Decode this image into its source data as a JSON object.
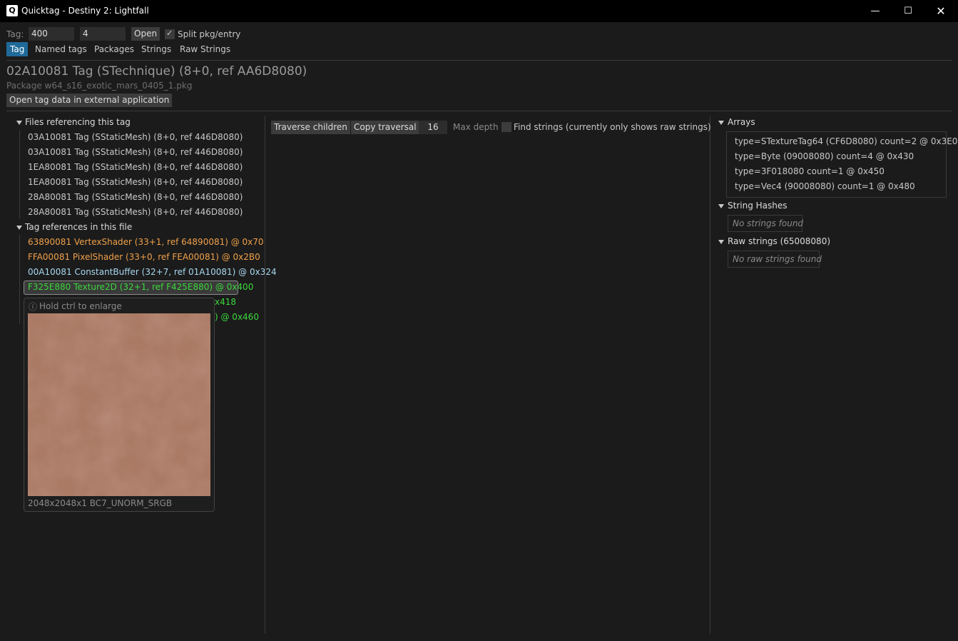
{
  "window": {
    "title": "Quicktag - Destiny 2: Lightfall",
    "icon_letter": "Q"
  },
  "toolbar": {
    "tag_label": "Tag:",
    "tag_value": "400",
    "entry_value": "4",
    "open_label": "Open",
    "split_label": "Split pkg/entry",
    "split_checked": true
  },
  "tabs": [
    "Tag",
    "Named tags",
    "Packages",
    "Strings",
    "Raw Strings"
  ],
  "header": {
    "title": "02A10081 Tag (STechnique) (8+0, ref AA6D8080)",
    "package": "Package w64_s16_exotic_mars_0405_1.pkg",
    "open_external": "Open tag data in external application"
  },
  "left": {
    "files_ref_title": "Files referencing this tag",
    "files_ref": [
      "03A10081 Tag (SStaticMesh) (8+0, ref 446D8080)",
      "03A10081 Tag (SStaticMesh) (8+0, ref 446D8080)",
      "1EA80081 Tag (SStaticMesh) (8+0, ref 446D8080)",
      "1EA80081 Tag (SStaticMesh) (8+0, ref 446D8080)",
      "28A80081 Tag (SStaticMesh) (8+0, ref 446D8080)",
      "28A80081 Tag (SStaticMesh) (8+0, ref 446D8080)"
    ],
    "tag_refs_title": "Tag references in this file",
    "tag_refs": [
      "63890081 VertexShader (33+1, ref 64890081) @ 0x70",
      "FFA00081 PixelShader (33+0, ref FEA00081) @ 0x2B0",
      "00A10081 ConstantBuffer (32+7, ref 01A10081) @ 0x324",
      "F325E880 Texture2D (32+1, ref F425E880) @ 0x400"
    ],
    "tag_refs_partial": [
      "x418",
      ") @ 0x460"
    ]
  },
  "tooltip": {
    "hint": "Hold ctrl to enlarge",
    "info": "2048x2048x1 BC7_UNORM_SRGB"
  },
  "middle": {
    "traverse_label": "Traverse children",
    "copy_label": "Copy traversal",
    "max_depth_value": "16",
    "max_depth_label": "Max depth",
    "find_strings_label": "Find strings (currently only shows raw strings)"
  },
  "right": {
    "arrays_title": "Arrays",
    "arrays": [
      "type=STextureTag64 (CF6D8080) count=2 @ 0x3E0",
      "type=Byte (09008080) count=4 @ 0x430",
      "type=3F018080 count=1 @ 0x450",
      "type=Vec4 (90008080) count=1 @ 0x480"
    ],
    "string_hashes_title": "String Hashes",
    "no_strings": "No strings found",
    "raw_strings_title": "Raw strings (65008080)",
    "no_raw_strings": "No raw strings found"
  },
  "colors": {
    "accent": "#1f6a99",
    "vertex_shader": "#f0a04a",
    "constant_buffer": "#a8d8f0",
    "texture": "#3cd83c",
    "texture_fill": "#b07a62"
  }
}
